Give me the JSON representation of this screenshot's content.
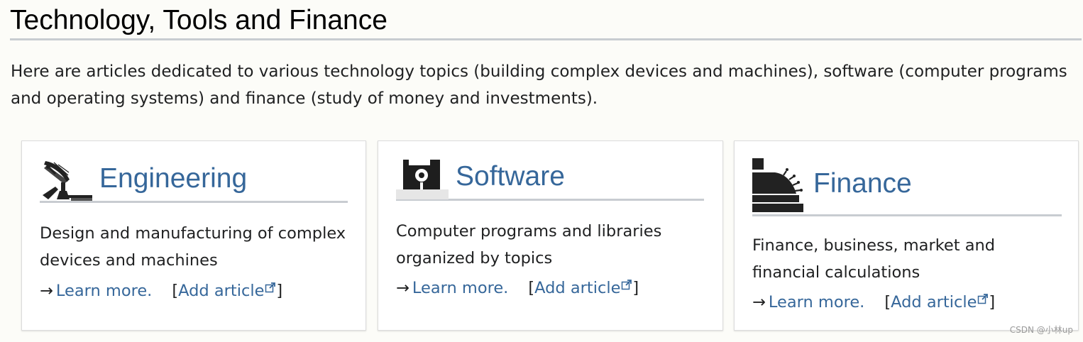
{
  "section": {
    "title": "Technology, Tools and Finance",
    "intro": "Here are articles dedicated to various technology topics (building complex devices and machines), software (computer programs and operating systems) and finance (study of money and investments)."
  },
  "cards": [
    {
      "title": "Engineering",
      "icon": "satellite-dish-icon",
      "description": "Design and manufacturing of complex devices and machines",
      "arrow": "→",
      "learn_more": "Learn more.",
      "bracket_open": "[",
      "add_article": "Add article",
      "bracket_close": "]"
    },
    {
      "title": "Software",
      "icon": "floppy-disk-icon",
      "description": "Computer programs and libraries organized by topics",
      "arrow": "→",
      "learn_more": "Learn more.",
      "bracket_open": "[",
      "add_article": "Add article",
      "bracket_close": "]"
    },
    {
      "title": "Finance",
      "icon": "cash-register-icon",
      "description": "Finance, business, market and financial calculations",
      "arrow": "→",
      "learn_more": "Learn more.",
      "bracket_open": "[",
      "add_article": "Add article",
      "bracket_close": "]"
    }
  ],
  "watermark": "CSDN @小林up",
  "colors": {
    "link": "#36679a",
    "heading_rule": "#c8ccd1",
    "background": "#fcfcf8",
    "text": "#202122"
  }
}
